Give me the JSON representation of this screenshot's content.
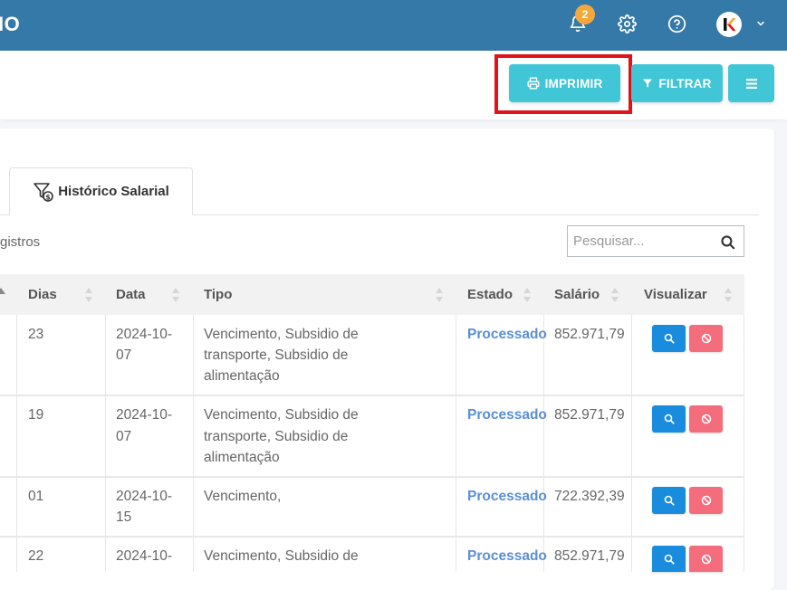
{
  "header": {
    "brand": "IO",
    "notifications_count": "2"
  },
  "actions": {
    "print_label": "IMPRIMIR",
    "filter_label": "FILTRAR"
  },
  "tab": {
    "label": "Histórico Salarial"
  },
  "list": {
    "registros_text": "gistros",
    "search_placeholder": "Pesquisar..."
  },
  "table": {
    "columns": [
      "Dias",
      "Data",
      "Tipo",
      "Estado",
      "Salário",
      "Visualizar"
    ],
    "rows": [
      {
        "dias": "23",
        "data_l1": "2024-10-",
        "data_l2": "07",
        "tipo_l1": "Vencimento, Subsidio de",
        "tipo_l2": "transporte, Subsidio de",
        "tipo_l3": "alimentação",
        "estado": "Processado",
        "salario": "852.971,79"
      },
      {
        "dias": "19",
        "data_l1": "2024-10-",
        "data_l2": "07",
        "tipo_l1": "Vencimento, Subsidio de",
        "tipo_l2": "transporte, Subsidio de",
        "tipo_l3": "alimentação",
        "estado": "Processado",
        "salario": "852.971,79"
      },
      {
        "dias": "01",
        "data_l1": "2024-10-",
        "data_l2": "15",
        "tipo_l1": "Vencimento,",
        "tipo_l2": "",
        "tipo_l3": "",
        "estado": "Processado",
        "salario": "722.392,39"
      },
      {
        "dias": "22",
        "data_l1": "2024-10-",
        "data_l2": "",
        "tipo_l1": "Vencimento, Subsidio de",
        "tipo_l2": "",
        "tipo_l3": "",
        "estado": "Processado",
        "salario": "852.971,79"
      }
    ]
  },
  "colors": {
    "topbar": "#3579a8",
    "accent": "#40c6d6",
    "view_button": "#1a8cde",
    "cancel_button": "#f36d7c",
    "estado_text": "#5b8fd6",
    "highlight": "#e0121a"
  },
  "icons": {
    "notifications": "bell-icon",
    "settings": "gear-icon",
    "help": "help-icon",
    "user": "avatar",
    "menu": "chevron-down-icon",
    "print": "printer-icon",
    "filter": "filter-icon",
    "more": "hamburger-icon",
    "tab": "filter-money-icon",
    "search": "search-icon",
    "view": "search-icon",
    "cancel": "ban-icon"
  }
}
